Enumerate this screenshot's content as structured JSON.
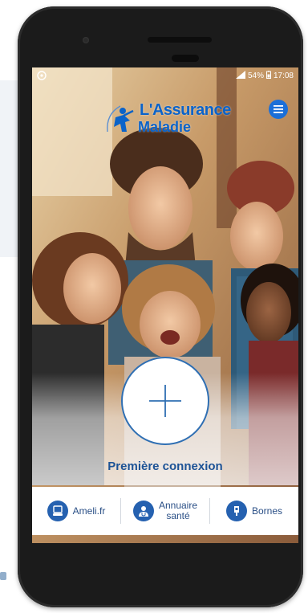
{
  "status_bar": {
    "left_icon": "android-notification-icon",
    "signal_icon": "signal-icon",
    "battery_text": "54%",
    "battery_icon": "battery-icon",
    "time": "17:08"
  },
  "header": {
    "menu_icon": "hamburger-menu-icon",
    "logo_line1": "L'Assurance",
    "logo_line2": "Maladie"
  },
  "main": {
    "plus_icon": "plus-icon",
    "first_connection_label": "Première connexion"
  },
  "bottom_bar": {
    "items": [
      {
        "label": "Ameli.fr",
        "icon": "computer-icon"
      },
      {
        "label_line1": "Annuaire",
        "label_line2": "santé",
        "icon": "doctor-icon"
      },
      {
        "label": "Bornes",
        "icon": "kiosk-icon"
      }
    ]
  },
  "colors": {
    "brand_blue": "#0b63c9",
    "icon_blue": "#2561b0",
    "label_blue": "#1d5396"
  }
}
